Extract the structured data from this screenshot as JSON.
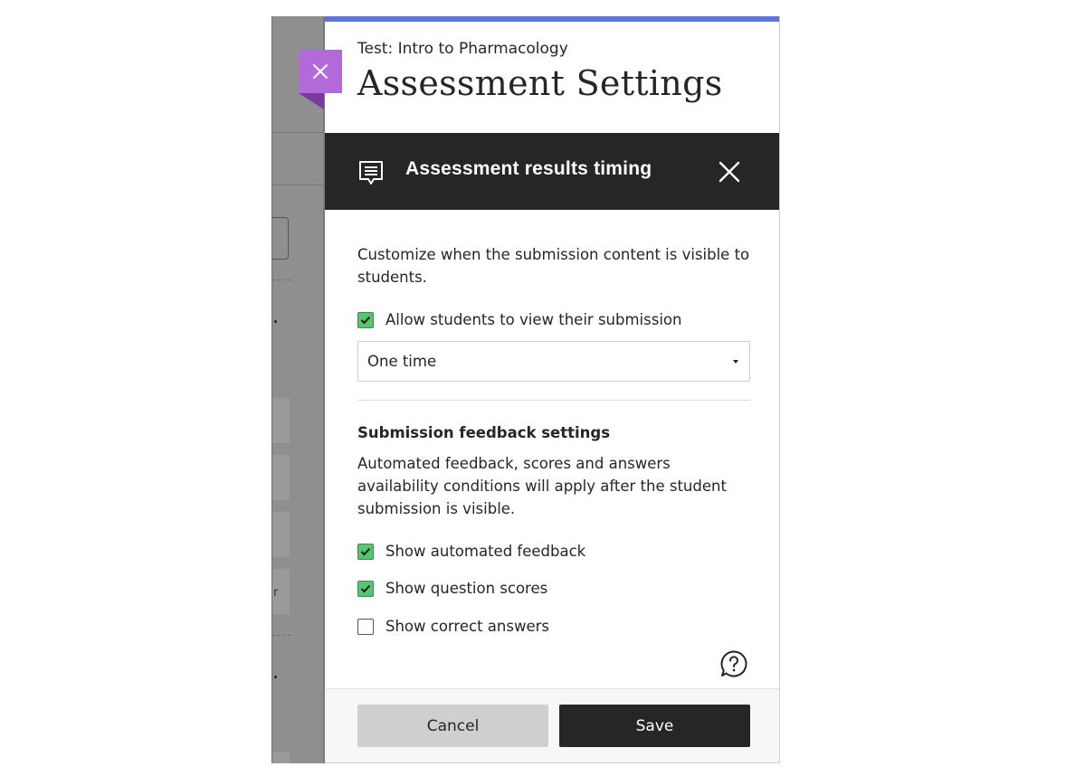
{
  "panel": {
    "subtitle": "Test: Intro to Pharmacology",
    "title": "Assessment Settings",
    "accent_color": "#5f73d9",
    "close_tab_color": "#b16ad8"
  },
  "section": {
    "title": "Assessment results timing",
    "icon": "comment-text-icon",
    "header_color": "#262626"
  },
  "content": {
    "description": "Customize when the submission content is visible to students.",
    "allow_view": {
      "label": "Allow students to view their submission",
      "checked": true
    },
    "visibility_select": {
      "value": "One time"
    },
    "feedback_heading": "Submission feedback settings",
    "feedback_description": "Automated feedback, scores and answers availability conditions will apply after the student submission is visible.",
    "options": [
      {
        "label": "Show automated feedback",
        "checked": true
      },
      {
        "label": "Show question scores",
        "checked": true
      },
      {
        "label": "Show correct answers",
        "checked": false
      }
    ],
    "checkbox_on_color": "#58c56f"
  },
  "footer": {
    "cancel_label": "Cancel",
    "save_label": "Save"
  },
  "background": {
    "truncated_char": "r"
  }
}
